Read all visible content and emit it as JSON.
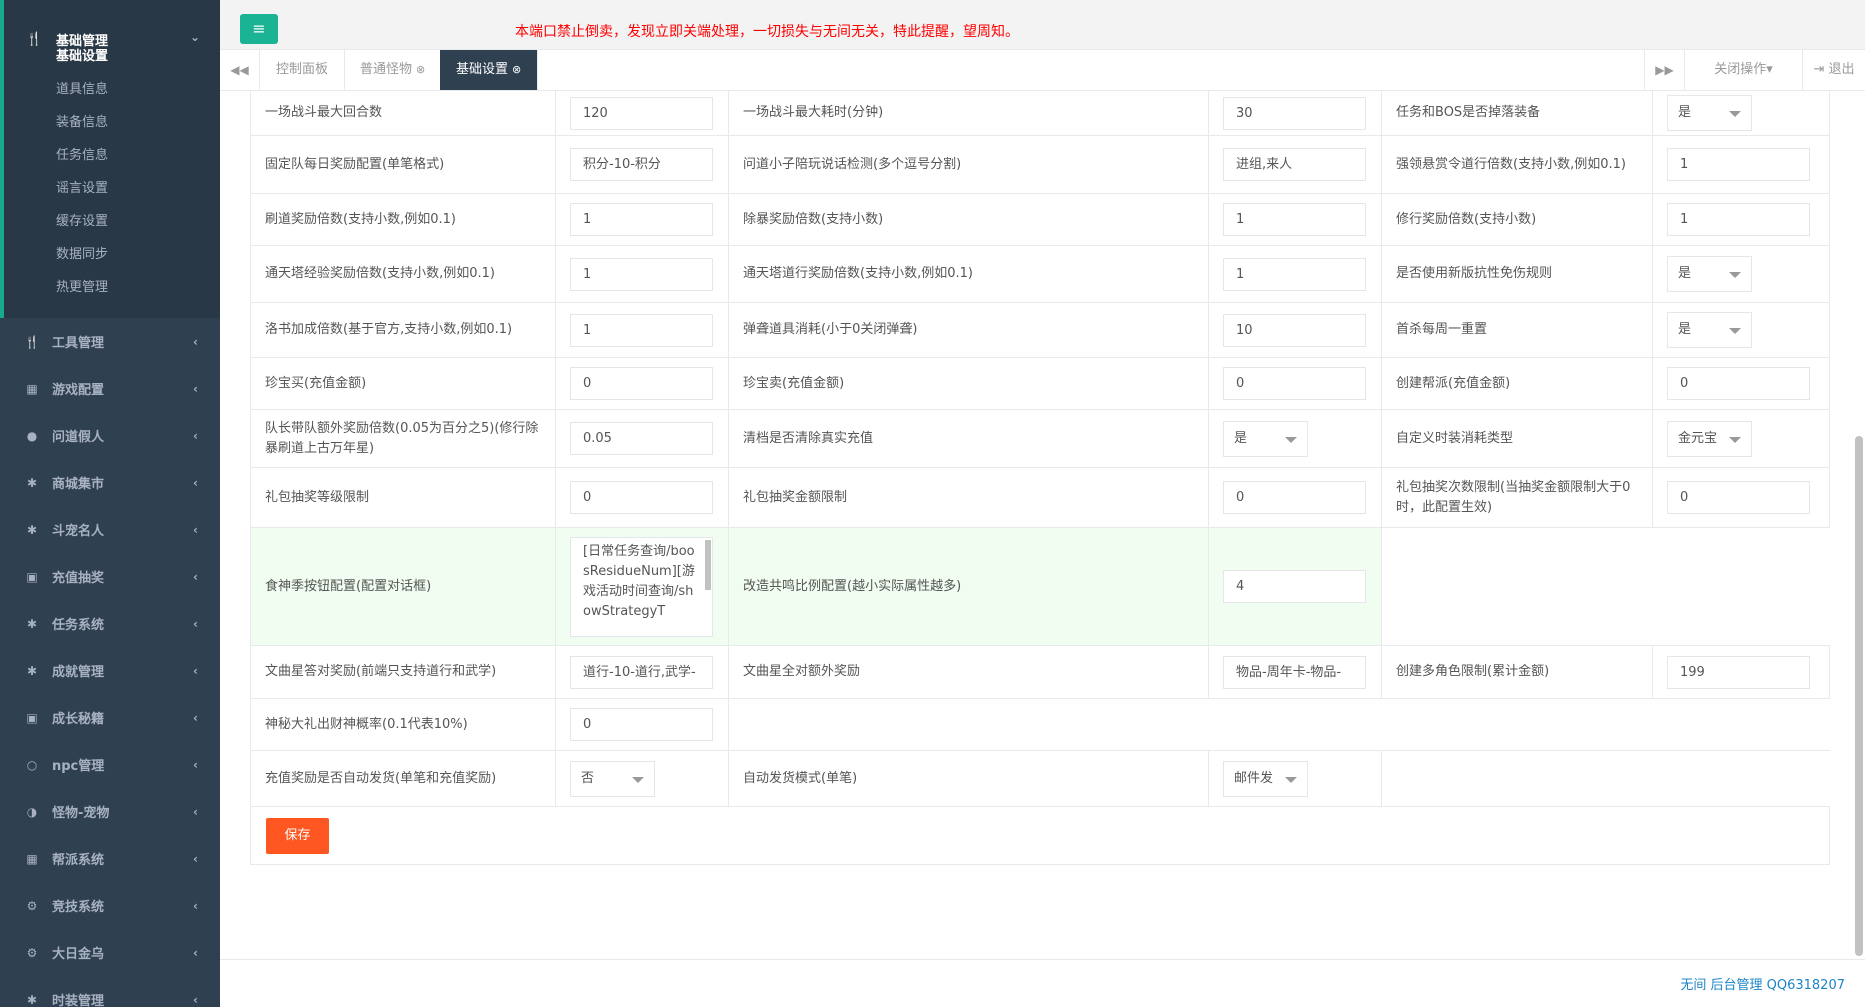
{
  "header": {
    "menu_icon": "hamburger-icon",
    "notice": "本端口禁止倒卖，发现立即关端处理，一切损失与无间无关，特此提醒，望周知。"
  },
  "sidebar": {
    "open_group": {
      "label": "基础管理",
      "icon": "cutlery-icon",
      "items": [
        "基础设置",
        "道具信息",
        "装备信息",
        "任务信息",
        "谣言设置",
        "缓存设置",
        "数据同步",
        "热更管理"
      ],
      "active": "基础设置"
    },
    "groups": [
      {
        "label": "工具管理",
        "icon": "cutlery-icon"
      },
      {
        "label": "游戏配置",
        "icon": "table-icon"
      },
      {
        "label": "问道假人",
        "icon": "user-icon"
      },
      {
        "label": "商城集市",
        "icon": "gear-icon"
      },
      {
        "label": "斗宠名人",
        "icon": "gear-icon"
      },
      {
        "label": "充值抽奖",
        "icon": "money-icon"
      },
      {
        "label": "任务系统",
        "icon": "gear-icon"
      },
      {
        "label": "成就管理",
        "icon": "gear-icon"
      },
      {
        "label": "成长秘籍",
        "icon": "money-icon"
      },
      {
        "label": "npc管理",
        "icon": "circle-icon"
      },
      {
        "label": "怪物-宠物",
        "icon": "adjust-icon"
      },
      {
        "label": "帮派系统",
        "icon": "table-icon"
      },
      {
        "label": "竞技系统",
        "icon": "gears-icon"
      },
      {
        "label": "大日金乌",
        "icon": "gears-icon"
      },
      {
        "label": "时装管理",
        "icon": "gear-icon"
      }
    ]
  },
  "tabs": {
    "items": [
      {
        "label": "控制面板",
        "closable": false
      },
      {
        "label": "普通怪物",
        "closable": true
      },
      {
        "label": "基础设置",
        "closable": true
      }
    ],
    "active": "基础设置",
    "close_ops": "关闭操作▾",
    "logout": "退出"
  },
  "form": {
    "rows": [
      [
        "一场战斗最大回合数",
        "120",
        "一场战斗最大耗时(分钟)",
        "30",
        "任务和BOS是否掉落装备",
        "是"
      ],
      [
        "固定队每日奖励配置(单笔格式)",
        "积分-10-积分",
        "问道小子陪玩说话检测(多个逗号分割)",
        "进组,来人",
        "强领悬赏令道行倍数(支持小数,例如0.1)",
        "1"
      ],
      [
        "刷道奖励倍数(支持小数,例如0.1)",
        "1",
        "除暴奖励倍数(支持小数)",
        "1",
        "修行奖励倍数(支持小数)",
        "1"
      ],
      [
        "通天塔经验奖励倍数(支持小数,例如0.1)",
        "1",
        "通天塔道行奖励倍数(支持小数,例如0.1)",
        "1",
        "是否使用新版抗性免伤规则",
        "是"
      ],
      [
        "洛书加成倍数(基于官方,支持小数,例如0.1)",
        "1",
        "弹聋道具消耗(小于0关闭弹聋)",
        "10",
        "首杀每周一重置",
        "是"
      ],
      [
        "珍宝买(充值金额)",
        "0",
        "珍宝卖(充值金额)",
        "0",
        "创建帮派(充值金额)",
        "0"
      ],
      [
        "队长带队额外奖励倍数(0.05为百分之5)(修行除暴刷道上古万年星)",
        "0.05",
        "清档是否清除真实充值",
        "是",
        "自定义时装消耗类型",
        "金元宝"
      ],
      [
        "礼包抽奖等级限制",
        "0",
        "礼包抽奖金额限制",
        "0",
        "礼包抽奖次数限制(当抽奖金额限制大于0时，此配置生效)",
        "0"
      ]
    ],
    "green_row": {
      "label1": "食神季按钮配置(配置对话框)",
      "textarea": "[日常任务查询/boosResidueNum][游戏活动时间查询/showStrategyT",
      "label2": "改造共鸣比例配置(越小实际属性越多)",
      "value2": "4"
    },
    "row10": [
      "文曲星答对奖励(前端只支持道行和武学)",
      "道行-10-道行,武学-",
      "文曲星全对额外奖励",
      "物品-周年卡-物品-",
      "创建多角色限制(累计金额)",
      "199"
    ],
    "row11": [
      "神秘大礼出财神概率(0.1代表10%)",
      "0"
    ],
    "row12": [
      "充值奖励是否自动发货(单笔和充值奖励)",
      "否",
      "自动发货模式(单笔)",
      "邮件发"
    ],
    "save_label": "保存"
  },
  "footer": {
    "text": "无间 后台管理 QQ6318207"
  }
}
